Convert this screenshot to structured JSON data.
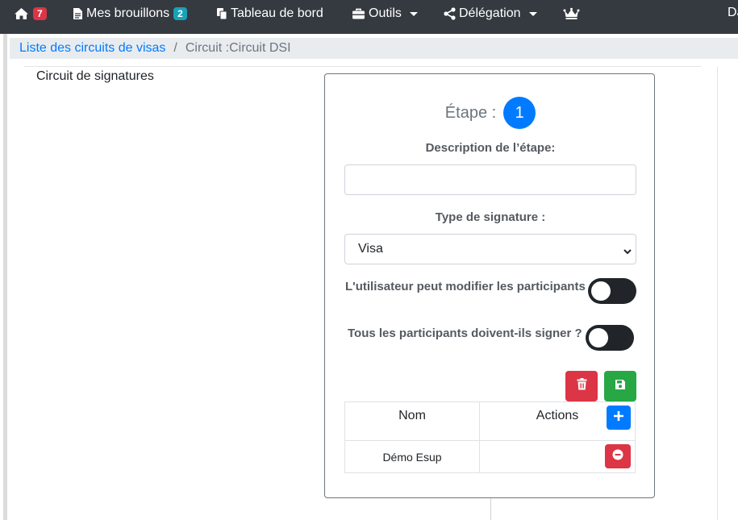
{
  "navbar": {
    "home_badge": "7",
    "drafts_label": "Mes brouillons",
    "drafts_badge": "2",
    "dashboard_label": "Tableau de bord",
    "tools_label": "Outils",
    "delegation_label": "Délégation",
    "partial_text": "Da",
    "colors": {
      "background": "#343a40",
      "badge_red": "#dc3545",
      "badge_cyan": "#17a2b8"
    }
  },
  "breadcrumb": {
    "link": "Liste des circuits de visas",
    "separator": "/",
    "current": "Circuit :Circuit DSI"
  },
  "section_title": "Circuit de signatures",
  "step": {
    "label": "Étape :",
    "number": "1",
    "description_label": "Description de l’étape:",
    "description_value": "",
    "signature_type_label": "Type de signature :",
    "signature_type_value": "Visa",
    "toggle_modify_label": "L'utilisateur peut modifier les participants",
    "toggle_modify_on": false,
    "toggle_all_sign_label": "Tous les participants doivent-ils signer ?",
    "toggle_all_sign_on": false
  },
  "participants": {
    "headers": [
      "Nom",
      "Actions"
    ],
    "rows": [
      {
        "name": "Démo Esup"
      }
    ]
  },
  "icons": [
    "home-icon",
    "file-signature-icon",
    "copy-icon",
    "toolbox-icon",
    "share-icon",
    "crown-icon",
    "trash-icon",
    "save-icon",
    "plus-icon",
    "minus-circle-icon",
    "chevron-down-icon"
  ],
  "colors": {
    "primary": "#007bff",
    "danger": "#dc3545",
    "success": "#28a745",
    "toggle_off": "#212529"
  }
}
